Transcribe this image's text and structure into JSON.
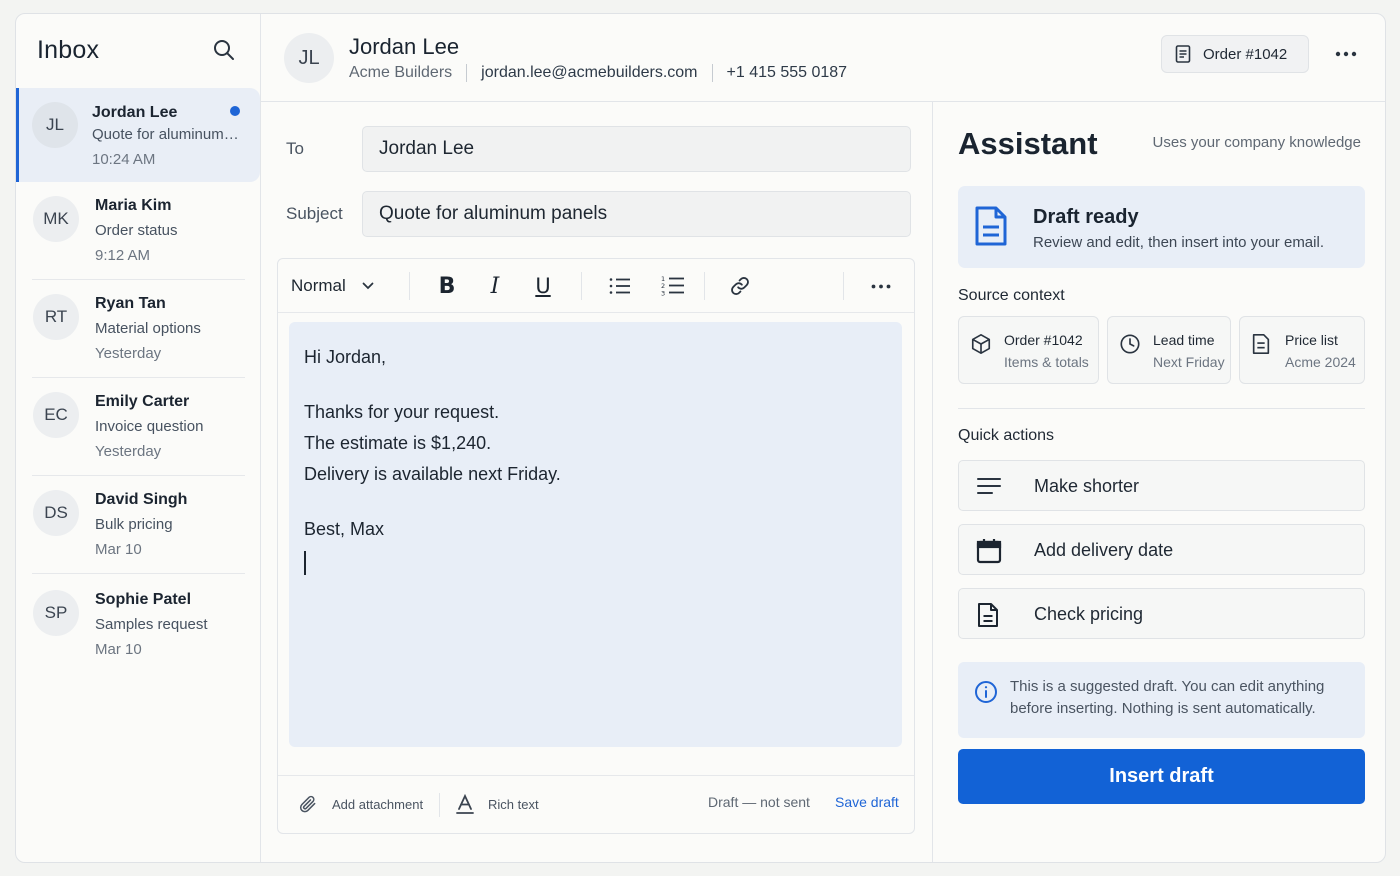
{
  "sidebar": {
    "title": "Inbox",
    "conversations": [
      {
        "initials": "JL",
        "name": "Jordan Lee",
        "snippet": "Quote for aluminum panels",
        "time": "10:24 AM"
      },
      {
        "initials": "MK",
        "name": "Maria Kim",
        "snippet": "Order status",
        "time": "9:12 AM"
      },
      {
        "initials": "RT",
        "name": "Ryan Tan",
        "snippet": "Material options",
        "time": "Yesterday"
      },
      {
        "initials": "EC",
        "name": "Emily Carter",
        "snippet": "Invoice question",
        "time": "Yesterday"
      },
      {
        "initials": "DS",
        "name": "David Singh",
        "snippet": "Bulk pricing",
        "time": "Mar 10"
      },
      {
        "initials": "SP",
        "name": "Sophie Patel",
        "snippet": "Samples request",
        "time": "Mar 10"
      }
    ]
  },
  "header": {
    "initials": "JL",
    "name": "Jordan Lee",
    "company": "Acme Builders",
    "email": "jordan.lee@acmebuilders.com",
    "phone": "+1 415 555 0187",
    "order_label": "Order #1042"
  },
  "composer": {
    "to_label": "To",
    "to_value": "Jordan Lee",
    "subject_label": "Subject",
    "subject_value": "Quote for aluminum panels",
    "toolbar": {
      "style": "Normal",
      "bold": "B",
      "italic": "I",
      "underline": "U"
    },
    "body": {
      "greeting": "Hi Jordan,",
      "line1": "Thanks for your request.",
      "line2": "The estimate is $1,240.",
      "line3": "Delivery is available next Friday.",
      "signoff": "Best, Max"
    },
    "footer": {
      "attachment": "Add attachment",
      "rich_text": "Rich text",
      "status": "Draft — not sent",
      "save": "Save draft"
    }
  },
  "assistant": {
    "title": "Assistant",
    "subtitle": "Uses your company knowledge",
    "draft": {
      "title": "Draft ready",
      "desc": "Review and edit, then insert into your email."
    },
    "source_label": "Source context",
    "sources": [
      {
        "title": "Order #1042",
        "sub": "Items & totals",
        "icon": "box-icon"
      },
      {
        "title": "Lead time",
        "sub": "Next Friday",
        "icon": "clock-icon"
      },
      {
        "title": "Price list",
        "sub": "Acme 2024",
        "icon": "document-icon"
      }
    ],
    "quick_label": "Quick actions",
    "actions": [
      {
        "label": "Make shorter",
        "icon": "lines-icon"
      },
      {
        "label": "Add delivery date",
        "icon": "calendar-icon"
      },
      {
        "label": "Check pricing",
        "icon": "document-icon"
      }
    ],
    "notice": "This is a suggested draft. You can edit anything before inserting. Nothing is sent automatically.",
    "insert_label": "Insert draft"
  },
  "colors": {
    "accent": "#1262d6",
    "unread": "#1f65d6",
    "highlight": "#e8eef7"
  }
}
